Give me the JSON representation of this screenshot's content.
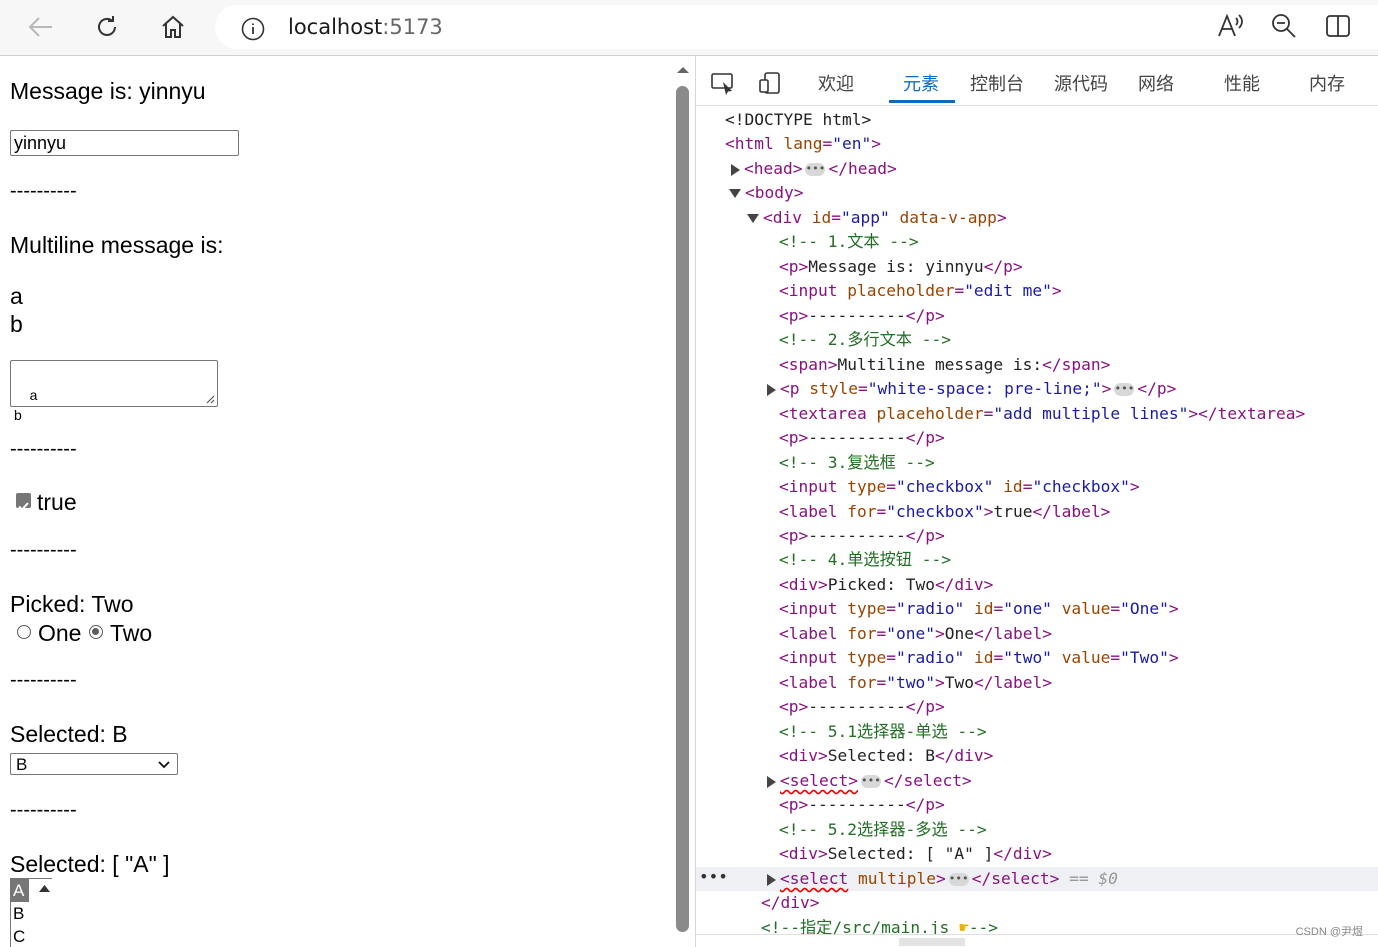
{
  "browser": {
    "url_host": "localhost",
    "url_port": ":5173"
  },
  "page": {
    "message_line": "Message is: yinnyu",
    "text_input_value": "yinnyu",
    "separator": "----------",
    "multiline_label": "Multiline message is:",
    "multiline_line1": "a",
    "multiline_line2": "b",
    "textarea_value": "a\nb",
    "checkbox_label": "true",
    "picked_line": "Picked: Two",
    "radio_one_label": "One",
    "radio_two_label": "Two",
    "selected_single_line": "Selected: B",
    "select_value": "B",
    "selected_multi_line": "Selected: [ \"A\" ]",
    "multi_options": [
      "A",
      "B",
      "C"
    ]
  },
  "devtools": {
    "tabs": [
      "欢迎",
      "元素",
      "控制台",
      "源代码",
      "网络",
      "性能",
      "内存"
    ],
    "active_tab": "元素",
    "selected_suffix": "== $0",
    "watermark": "CSDN @尹煜"
  }
}
